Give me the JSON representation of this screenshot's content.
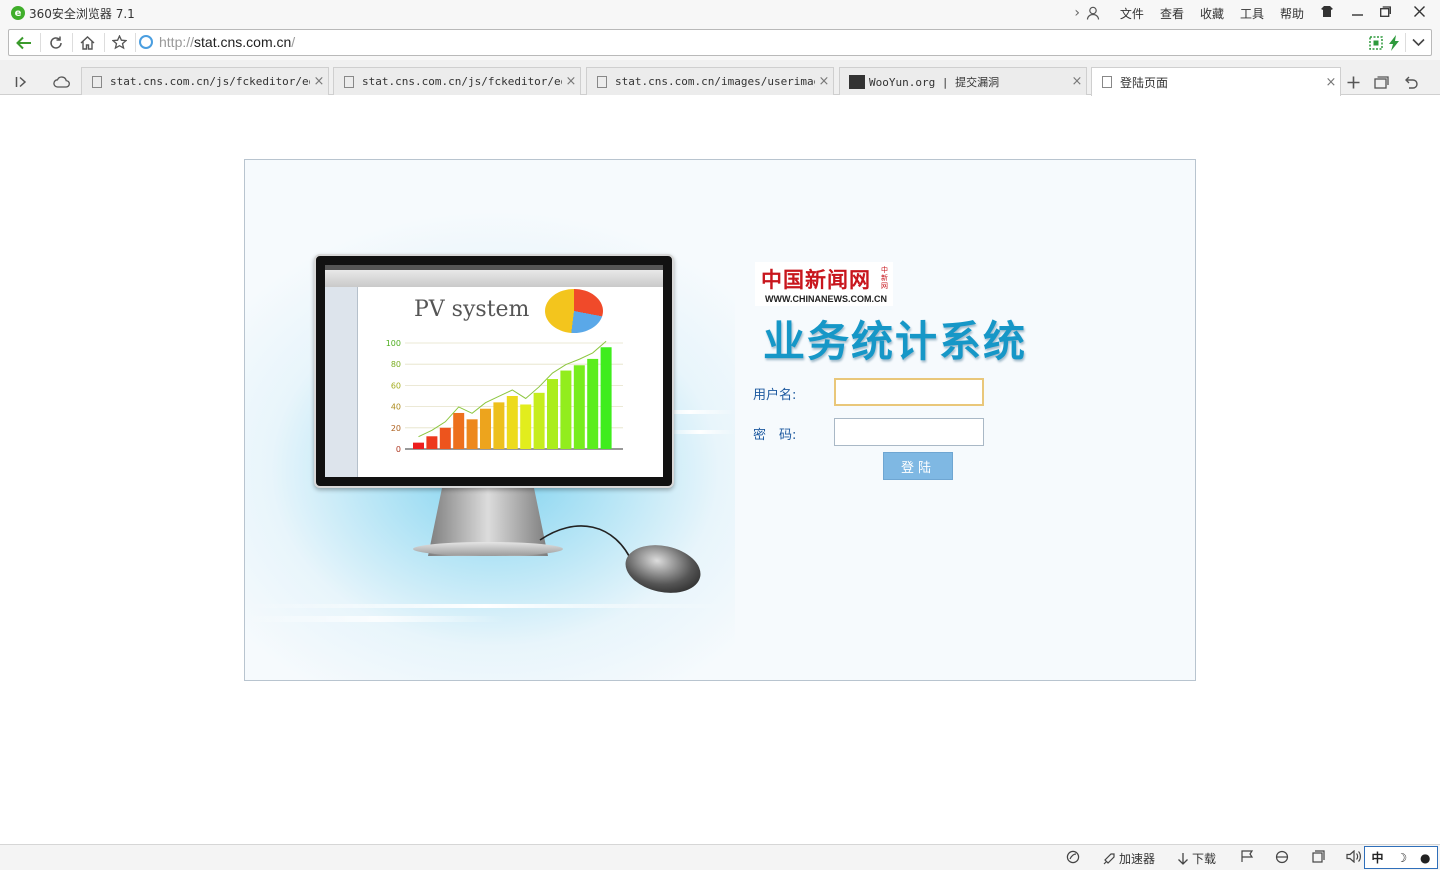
{
  "window": {
    "title": "360安全浏览器 7.1",
    "menu": [
      "文件",
      "查看",
      "收藏",
      "工具",
      "帮助"
    ]
  },
  "address_bar": {
    "url_prefix": "http://",
    "url_domain": "stat.cns.com.cn",
    "url_suffix": "/"
  },
  "tabs": [
    {
      "label": "stat.cns.com.cn/js/fckeditor/edit",
      "active": false
    },
    {
      "label": "stat.cns.com.cn/js/fckeditor/edit",
      "active": false
    },
    {
      "label": "stat.cns.com.cn/images/userimage/",
      "active": false
    },
    {
      "label": "WooYun.org | 提交漏洞",
      "active": false
    },
    {
      "label": "登陆页面",
      "active": true
    }
  ],
  "page": {
    "illustration": {
      "screen_title": "PV system",
      "y_ticks": [
        "100",
        "80",
        "60",
        "40",
        "20",
        "0"
      ],
      "bar_values": [
        6,
        12,
        20,
        34,
        28,
        38,
        44,
        50,
        42,
        53,
        66,
        74,
        79,
        85,
        96
      ]
    },
    "brand": {
      "chinese": "中国新闻网",
      "side": "中新网",
      "english": "WWW.CHINANEWS.COM.CN"
    },
    "system_title": "业务统计系统",
    "form": {
      "username_label": "用户名:",
      "username_value": "",
      "password_label": "密　码:",
      "password_value": "",
      "submit_label": "登陆"
    }
  },
  "status_bar": {
    "accelerator": "加速器",
    "download": "下载",
    "ime": [
      "中",
      "☽",
      "●"
    ]
  },
  "colors": {
    "accent": "#1697c7",
    "brand_red": "#c8161d",
    "button": "#7fb8e3",
    "label": "#1e5aa0"
  }
}
